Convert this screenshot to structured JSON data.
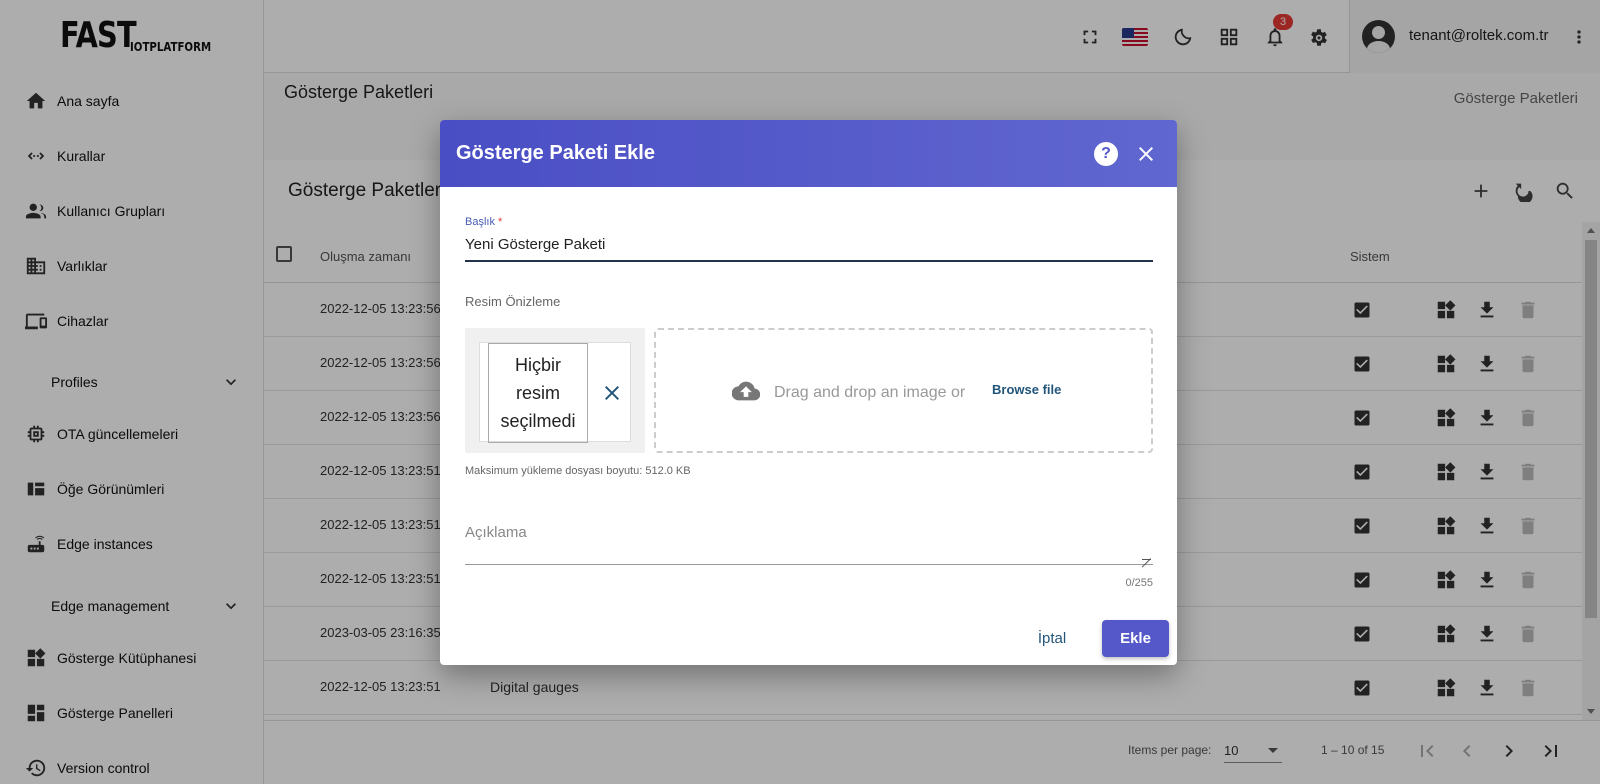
{
  "logo": {
    "big": "FAST",
    "small": "IOTPLATFORM"
  },
  "sidebar": {
    "items": [
      {
        "label": "Ana sayfa",
        "icon": "home-icon"
      },
      {
        "label": "Kurallar",
        "icon": "rule-chain-icon"
      },
      {
        "label": "Kullanıcı Grupları",
        "icon": "people-icon"
      },
      {
        "label": "Varlıklar",
        "icon": "building-icon"
      },
      {
        "label": "Cihazlar",
        "icon": "devices-icon"
      },
      {
        "label": "OTA güncellemeleri",
        "icon": "chip-icon"
      },
      {
        "label": "Öğe Görünümleri",
        "icon": "view-quilt-icon"
      },
      {
        "label": "Edge instances",
        "icon": "router-icon"
      },
      {
        "label": "Gösterge Kütüphanesi",
        "icon": "widgets-icon"
      },
      {
        "label": "Gösterge Panelleri",
        "icon": "dashboard-icon"
      },
      {
        "label": "Version control",
        "icon": "history-icon"
      }
    ],
    "groups": [
      {
        "label": "Profiles"
      },
      {
        "label": "Edge management"
      }
    ]
  },
  "topbar": {
    "notifications_count": "3",
    "user_email": "tenant@roltek.com.tr"
  },
  "page": {
    "title": "Gösterge Paketleri",
    "breadcrumb": "Gösterge Paketleri"
  },
  "card": {
    "title": "Gösterge Paketleri",
    "columns": {
      "created": "Oluşma zamanı",
      "system": "Sistem"
    },
    "rows": [
      {
        "date": "2022-12-05 13:23:56",
        "name": ""
      },
      {
        "date": "2022-12-05 13:23:56",
        "name": ""
      },
      {
        "date": "2022-12-05 13:23:56",
        "name": ""
      },
      {
        "date": "2022-12-05 13:23:51",
        "name": ""
      },
      {
        "date": "2022-12-05 13:23:51",
        "name": ""
      },
      {
        "date": "2022-12-05 13:23:51",
        "name": ""
      },
      {
        "date": "2023-03-05 23:16:35",
        "name": ""
      },
      {
        "date": "2022-12-05 13:23:51",
        "name": "Digital gauges"
      }
    ]
  },
  "paginator": {
    "items_per_page_label": "Items per page:",
    "page_size": "10",
    "range": "1 – 10 of 15"
  },
  "dialog": {
    "title": "Gösterge Paketi Ekle",
    "help": "?",
    "title_label": "Başlık",
    "required_mark": "*",
    "title_value": "Yeni Gösterge Paketi",
    "preview_label": "Resim Önizleme",
    "no_image": "Hiçbir resim seçilmedi",
    "drop_text": "Drag and drop an image or",
    "browse": "Browse file",
    "max_size": "Maksimum yükleme dosyası boyutu: 512.0 KB",
    "description_placeholder": "Açıklama",
    "counter": "0/255",
    "cancel": "İptal",
    "add": "Ekle"
  },
  "colors": {
    "dialog_header": "#5458c9",
    "primary_button": "#5458c9",
    "link": "#22557a",
    "badge": "#e53935"
  }
}
